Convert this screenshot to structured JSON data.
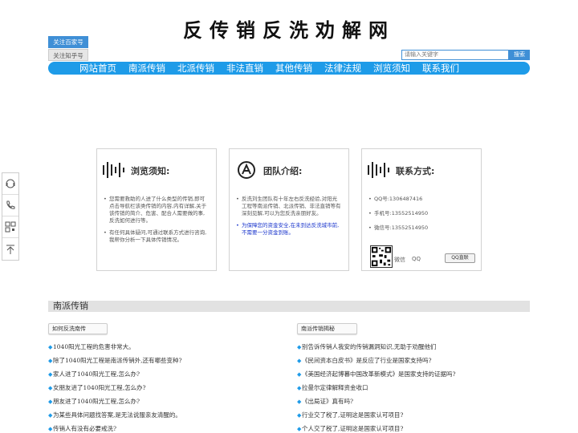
{
  "header": {
    "title": "反传销反洗劝解网",
    "follow_buttons": [
      "关注百家号",
      "关注知乎号"
    ],
    "search": {
      "placeholder": "请输入关键字",
      "button": "搜索"
    }
  },
  "nav": [
    "网站首页",
    "南派传销",
    "北派传销",
    "非法直销",
    "其他传销",
    "法律法规",
    "浏览须知",
    "联系我们"
  ],
  "side_icons": [
    "headset-icon",
    "phone-icon",
    "qrcode-icon",
    "back-to-top-icon"
  ],
  "cards": {
    "browse": {
      "title": "浏览须知:",
      "items": [
        "您需要救助的人进了什么类型的传销,即可点击导航栏该类传销的内容,内有详解,关于该传销的简介、危害、配合人需要做的事,反洗如何进行等。",
        "有任何具体疑问,可通过联系方式进行咨询,我帮你分析一下具体传销情况。"
      ]
    },
    "team": {
      "title": "团队介绍:",
      "items": [
        "反洗刘生团队有十年左右反洗经验,对阳光工程等南派传销、北派传销、非法直销等有深刻见解,可以为您反洗亲朋好友。",
        "为保障您的资金安全,在未到达反洗城市前,不需要一分资金到账。"
      ]
    },
    "contact": {
      "title": "联系方式:",
      "items": [
        "QQ号:1306487416",
        "手机号:13552514950",
        "微信号:13552514950"
      ],
      "qr_label": "微信",
      "qq_label": "QQ",
      "qq_badge": "QQ直联"
    }
  },
  "section": {
    "title": "南派传销",
    "left": {
      "tab": "如何反洗南传",
      "items": [
        "1040阳光工程的危害非常大。",
        "除了1040阳光工程是南派传销外,还有哪些变种?",
        "家人进了1040阳光工程,怎么办?",
        "女朋友进了1040阳光工程,怎么办?",
        "朋友进了1040阳光工程,怎么办?",
        "为某些具体问题找答案,是无法说服亲友清醒的。",
        "传销人有没有必要戒洗?"
      ]
    },
    "right": {
      "tab": "南派传销揭秘",
      "items": [
        "别告诉传销人我安的传销漏洞知识,无助于劝醒他们",
        "《民间资本白皮书》是反应了行业是国家支持吗?",
        "《美国经济起博暮中国改革新模式》是国家支持的证据吗?",
        "拉曼尔定律解释资金收口",
        "《出局证》真有吗?",
        "行业交了税了,证明这是国家认可项目?",
        "个人交了税了,证明这是国家认可项目?"
      ]
    }
  }
}
